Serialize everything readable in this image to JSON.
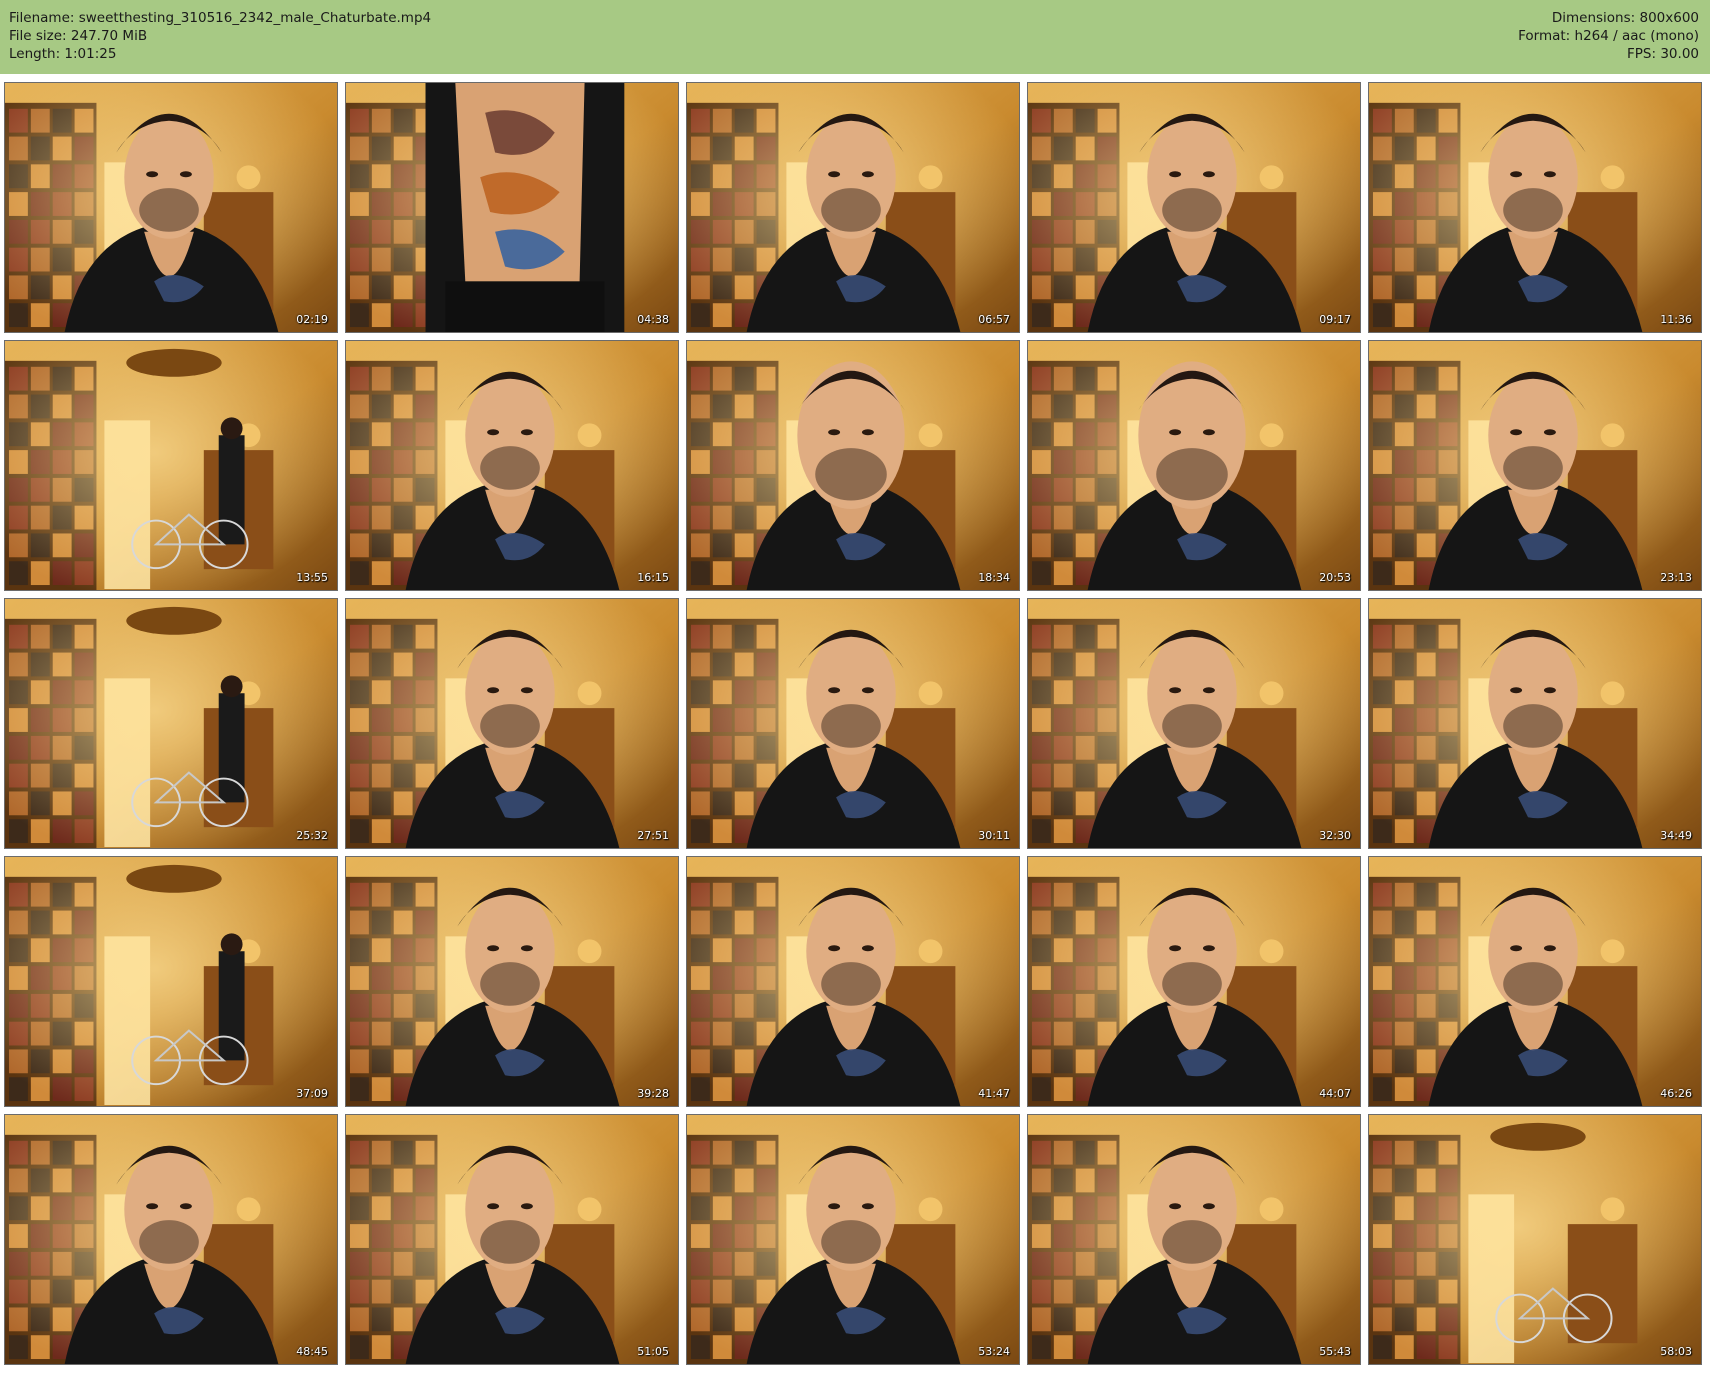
{
  "meta": {
    "filename": "Filename: sweetthesting_310516_2342_male_Chaturbate.mp4",
    "filesize": "File size: 247.70 MiB",
    "length": "Length: 1:01:25",
    "dimensions": "Dimensions: 800x600",
    "format": "Format: h264 / aac (mono)",
    "fps": "FPS: 30.00"
  },
  "colors": {
    "header_bg": "#a7c984",
    "room_warm": "#c98a2e",
    "room_dark": "#6b3f10",
    "shirt": "#1a1a1a"
  },
  "thumbnails": [
    {
      "time": "02:19",
      "scene": "face"
    },
    {
      "time": "04:38",
      "scene": "torso"
    },
    {
      "time": "06:57",
      "scene": "face"
    },
    {
      "time": "09:17",
      "scene": "face"
    },
    {
      "time": "11:36",
      "scene": "face"
    },
    {
      "time": "13:55",
      "scene": "room-person"
    },
    {
      "time": "16:15",
      "scene": "face"
    },
    {
      "time": "18:34",
      "scene": "face-close"
    },
    {
      "time": "20:53",
      "scene": "face-close"
    },
    {
      "time": "23:13",
      "scene": "face"
    },
    {
      "time": "25:32",
      "scene": "room-person"
    },
    {
      "time": "27:51",
      "scene": "face"
    },
    {
      "time": "30:11",
      "scene": "face"
    },
    {
      "time": "32:30",
      "scene": "face"
    },
    {
      "time": "34:49",
      "scene": "face"
    },
    {
      "time": "37:09",
      "scene": "room-person"
    },
    {
      "time": "39:28",
      "scene": "face"
    },
    {
      "time": "41:47",
      "scene": "face"
    },
    {
      "time": "44:07",
      "scene": "face"
    },
    {
      "time": "46:26",
      "scene": "face"
    },
    {
      "time": "48:45",
      "scene": "face"
    },
    {
      "time": "51:05",
      "scene": "face"
    },
    {
      "time": "53:24",
      "scene": "face"
    },
    {
      "time": "55:43",
      "scene": "face"
    },
    {
      "time": "58:03",
      "scene": "room-empty"
    }
  ]
}
